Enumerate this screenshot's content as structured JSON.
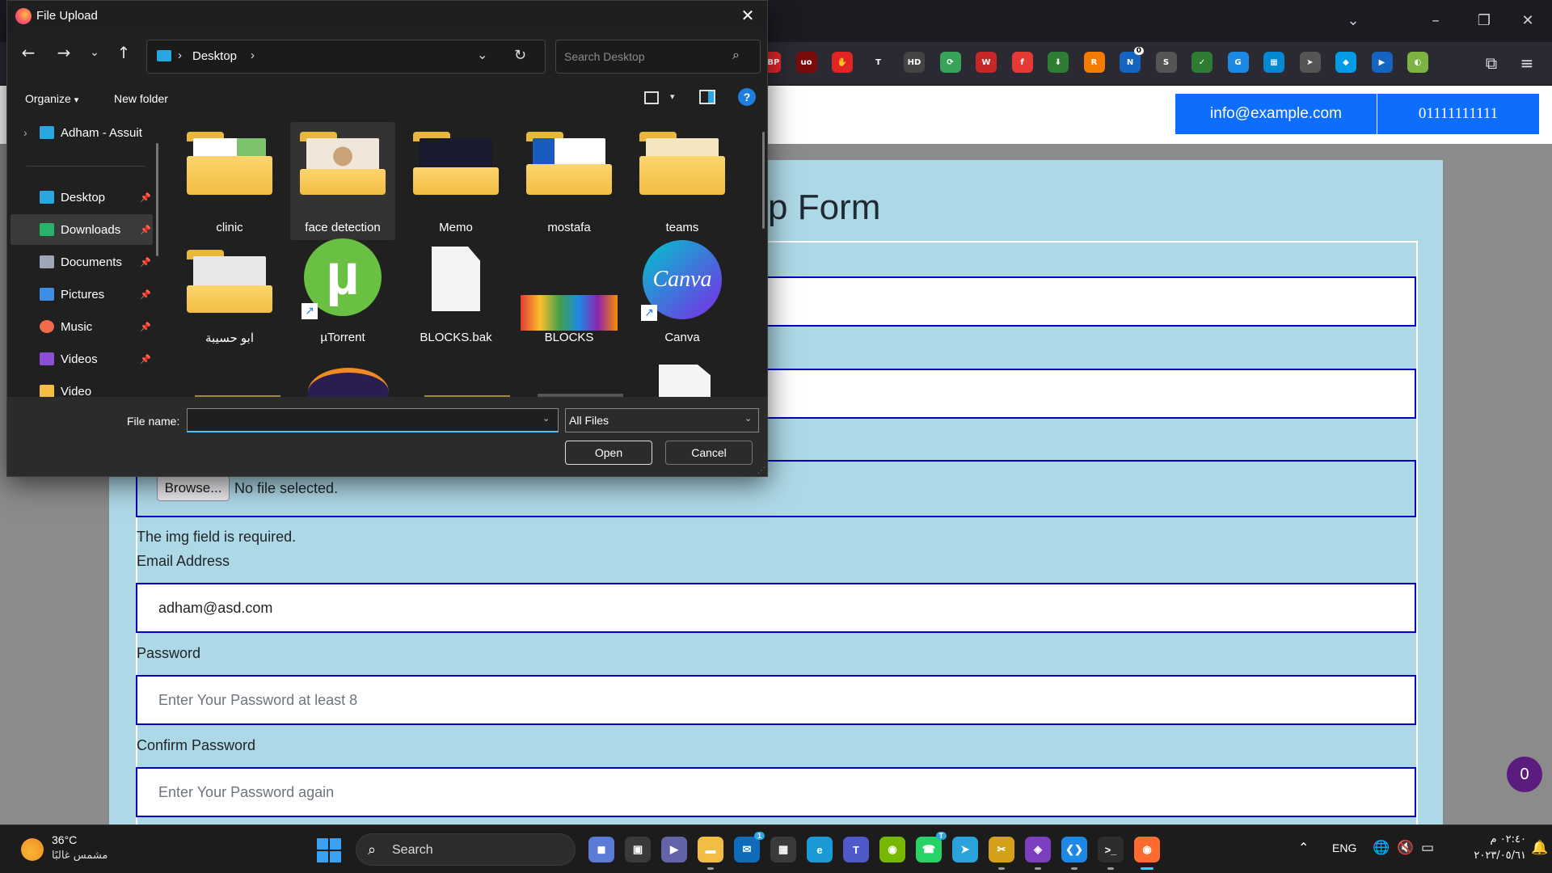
{
  "browser": {
    "tabs_dropdown_icon": "chevron-down-icon",
    "window_controls": [
      "minimize-icon",
      "restore-icon",
      "close-icon"
    ],
    "extensions": [
      {
        "name": "abp-icon",
        "label": "ABP",
        "color": "#e4252a"
      },
      {
        "name": "ublock-icon",
        "label": "uo",
        "color": "#7a0c0c"
      },
      {
        "name": "stop-hand-icon",
        "label": "✋",
        "color": "#e32424"
      },
      {
        "name": "t-icon",
        "label": "T",
        "color": "#2b2a33"
      },
      {
        "name": "hd-icon",
        "label": "HD",
        "color": "#444"
      },
      {
        "name": "refresh-green-icon",
        "label": "⟳",
        "color": "#3aa35a"
      },
      {
        "name": "shield-red-icon",
        "label": "W",
        "color": "#c62828"
      },
      {
        "name": "f-icon",
        "label": "f",
        "color": "#e53935"
      },
      {
        "name": "download-green-icon",
        "label": "⬇",
        "color": "#2e7d32"
      },
      {
        "name": "rss-icon",
        "label": "R",
        "color": "#f57c00"
      },
      {
        "name": "notes-icon",
        "label": "N",
        "color": "#1565c0",
        "badge": "0"
      },
      {
        "name": "spy-icon",
        "label": "S",
        "color": "#555"
      },
      {
        "name": "shield-check-icon",
        "label": "✓",
        "color": "#2e7d32"
      },
      {
        "name": "translate-icon",
        "label": "G",
        "color": "#1e88e5"
      },
      {
        "name": "grid-icon",
        "label": "▦",
        "color": "#0288d1"
      },
      {
        "name": "cursor-icon",
        "label": "➤",
        "color": "#555"
      },
      {
        "name": "diamond-icon",
        "label": "◆",
        "color": "#039be5"
      },
      {
        "name": "play-icon",
        "label": "▶",
        "color": "#1565c0"
      },
      {
        "name": "color-picker-icon",
        "label": "◐",
        "color": "#7cb342"
      }
    ]
  },
  "site": {
    "email": "info@example.com",
    "phone": "01111111111",
    "form_title_visible": "p Form",
    "fields": {
      "file_button": "Browse...",
      "file_status": "No file selected.",
      "img_error": "The img field is required.",
      "email_label": "Email Address",
      "email_value": "adham@asd.com",
      "password_label": "Password",
      "password_placeholder": "Enter Your Password at least 8",
      "confirm_label": "Confirm Password",
      "confirm_placeholder": "Enter Your Password again"
    },
    "chat_count": "0"
  },
  "dialog": {
    "title": "File Upload",
    "address": {
      "location": "Desktop",
      "separator": "›"
    },
    "search_placeholder": "Search Desktop",
    "commands": {
      "organize": "Organize",
      "organize_arrow": "▾",
      "new_folder": "New folder",
      "help": "?"
    },
    "sidebar": [
      {
        "label": "Adham - Assuit",
        "icon_color": "#2aa7e1",
        "pinned": false,
        "expand": "›"
      },
      {
        "label": "Desktop",
        "icon_color": "#2aa7e1",
        "pinned": true
      },
      {
        "label": "Downloads",
        "icon_color": "#29b36a",
        "pinned": true,
        "selected": true
      },
      {
        "label": "Documents",
        "icon_color": "#9ea7b8",
        "pinned": true
      },
      {
        "label": "Pictures",
        "icon_color": "#3d8fe6",
        "pinned": true
      },
      {
        "label": "Music",
        "icon_color": "#ef6b4a",
        "pinned": true
      },
      {
        "label": "Videos",
        "icon_color": "#8c4fd6",
        "pinned": true
      },
      {
        "label": "Video",
        "icon_color": "#f2bd43",
        "pinned": false
      }
    ],
    "items": [
      {
        "label": "clinic",
        "kind": "folder"
      },
      {
        "label": "face detection",
        "kind": "folder",
        "selected": true
      },
      {
        "label": "Memo",
        "kind": "folder"
      },
      {
        "label": "mostafa",
        "kind": "folder"
      },
      {
        "label": "teams",
        "kind": "folder"
      },
      {
        "label": "ابو حسيبة",
        "kind": "folder"
      },
      {
        "label": "µTorrent",
        "kind": "shortcut"
      },
      {
        "label": "BLOCKS.bak",
        "kind": "file"
      },
      {
        "label": "BLOCKS",
        "kind": "image"
      },
      {
        "label": "Canva",
        "kind": "shortcut"
      }
    ],
    "utorrent_glyph": "µ",
    "canva_glyph": "Canva",
    "file_name_label": "File name:",
    "file_name_value": "",
    "file_type": "All Files",
    "open_label": "Open",
    "cancel_label": "Cancel"
  },
  "taskbar": {
    "weather_temp": "36°C",
    "weather_desc": "مشمس غالبًا",
    "search_label": "Search",
    "apps": [
      {
        "name": "widgets-app",
        "color": "#5b7bd6",
        "glyph": "◼"
      },
      {
        "name": "task-view-app",
        "color": "#3a3a3a",
        "glyph": "▣"
      },
      {
        "name": "teams-chat-app",
        "color": "#6264a7",
        "glyph": "▶"
      },
      {
        "name": "file-explorer-app",
        "color": "#f2bd43",
        "glyph": "▬",
        "running": true
      },
      {
        "name": "mail-app",
        "color": "#0f6cbd",
        "glyph": "✉",
        "badge": "1"
      },
      {
        "name": "store-app",
        "color": "#3a3a3a",
        "glyph": "▦"
      },
      {
        "name": "edge-app",
        "color": "#1a9bd7",
        "glyph": "e"
      },
      {
        "name": "teams-app",
        "color": "#5059c9",
        "glyph": "T"
      },
      {
        "name": "nvidia-app",
        "color": "#76b900",
        "glyph": "◉"
      },
      {
        "name": "whatsapp-app",
        "color": "#25d366",
        "glyph": "☎",
        "badge": "T"
      },
      {
        "name": "telegram-app",
        "color": "#2aa3dd",
        "glyph": "➤"
      },
      {
        "name": "snip-app",
        "color": "#d4a017",
        "glyph": "✂",
        "running": true
      },
      {
        "name": "visual-studio-app",
        "color": "#7b3fbf",
        "glyph": "◈",
        "running": true
      },
      {
        "name": "vscode-app",
        "color": "#1e88e5",
        "glyph": "❮❯",
        "running": true
      },
      {
        "name": "terminal-app",
        "color": "#2d2d2d",
        "glyph": ">_",
        "running": true
      },
      {
        "name": "firefox-app",
        "color": "#ff6a2f",
        "glyph": "◉",
        "running": true,
        "active": true
      }
    ],
    "language": "ENG",
    "time": "٠٢:٤٠ م",
    "date": "٢٠٢٣/٠٥/٦١"
  }
}
